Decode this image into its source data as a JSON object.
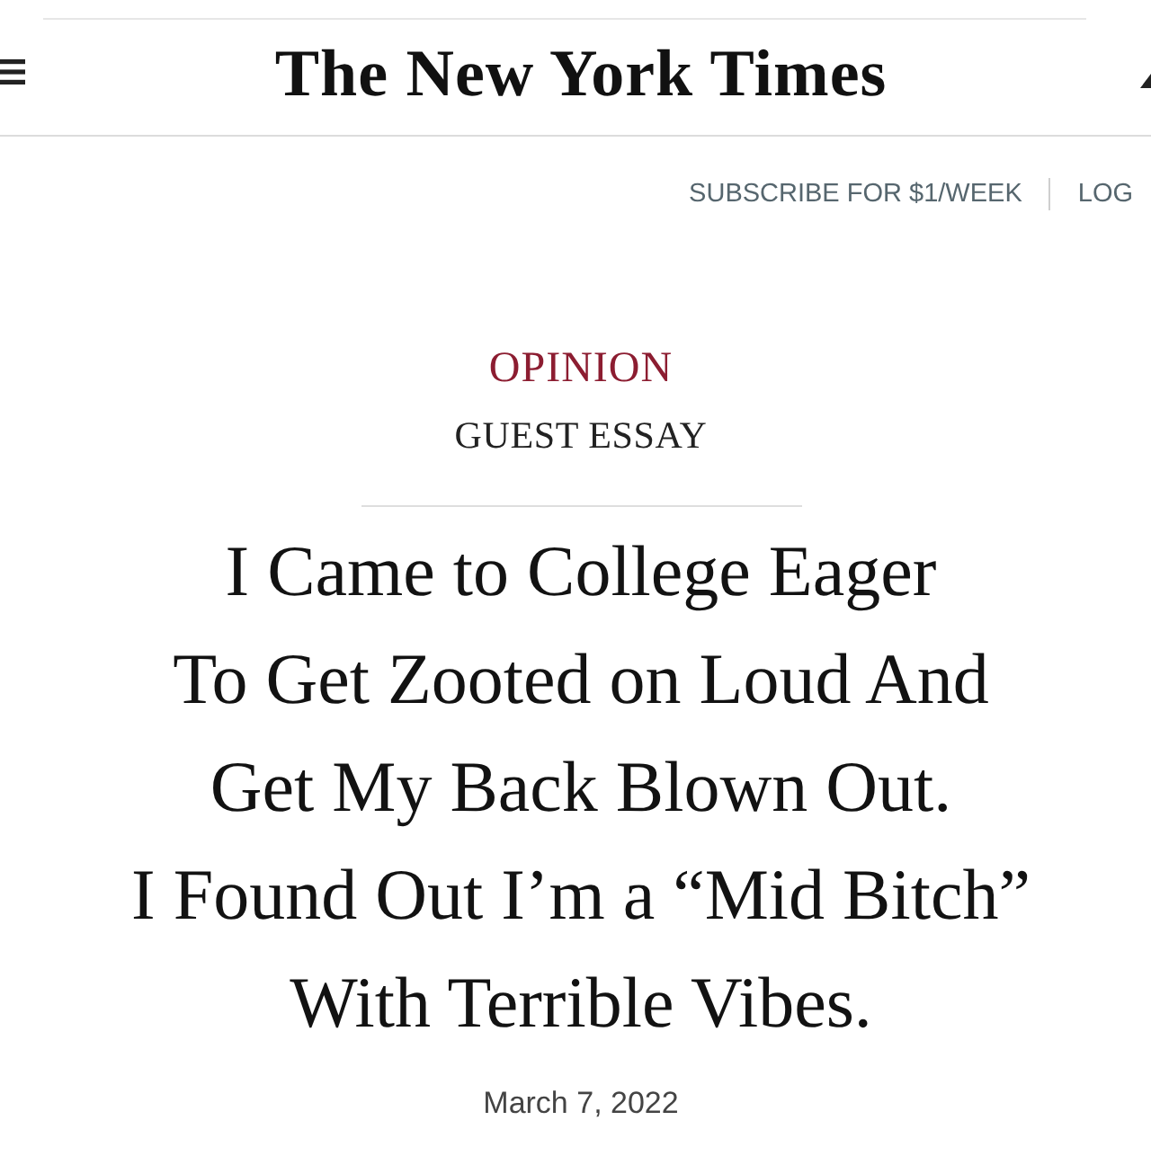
{
  "masthead": {
    "logo": "The New York Times"
  },
  "account_bar": {
    "subscribe_link": "SUBSCRIBE FOR $1/WEEK",
    "login_link": "LOG"
  },
  "article": {
    "section": "OPINION",
    "label": "GUEST ESSAY",
    "headline_lines": [
      "I Came to College Eager",
      "To Get Zooted on Loud And",
      "Get My Back Blown Out.",
      "I Found Out I’m a “Mid Bitch”",
      "With Terrible Vibes."
    ],
    "date": "March 7, 2022"
  }
}
